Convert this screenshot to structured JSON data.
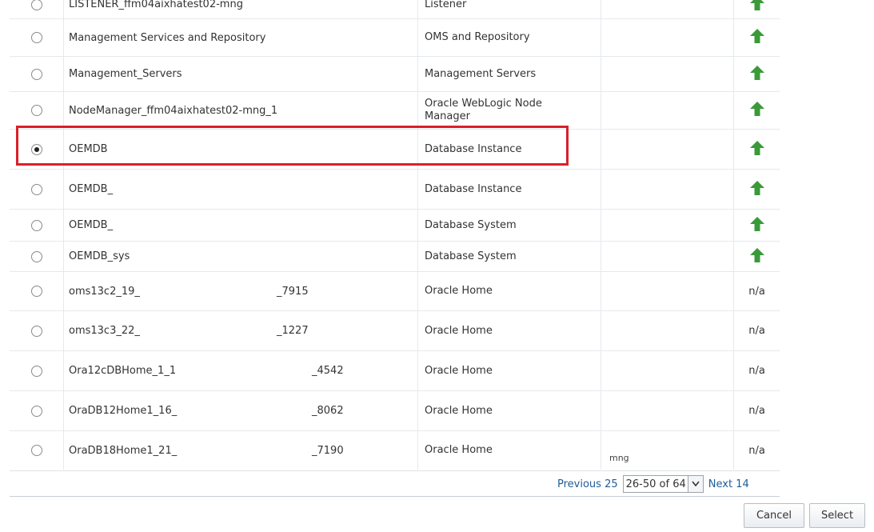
{
  "rows": [
    {
      "name_a": "LISTENER_ffm04aixhatest02-mng",
      "name_b": "",
      "type": "Listener",
      "status": "up",
      "checked": false
    },
    {
      "name_a": "Management Services and Repository",
      "name_b": "",
      "type": "OMS and Repository",
      "status": "up",
      "checked": false
    },
    {
      "name_a": "Management_Servers",
      "name_b": "",
      "type": "Management Servers",
      "status": "up",
      "checked": false
    },
    {
      "name_a": "NodeManager_ffm04aixhatest02-mng_1",
      "name_b": "",
      "type": "Oracle WebLogic Node Manager",
      "status": "up",
      "checked": false
    },
    {
      "name_a": "OEMDB",
      "name_b": "",
      "type": "Database Instance",
      "status": "up",
      "checked": true
    },
    {
      "name_a": "OEMDB_",
      "name_b": "",
      "type": "Database Instance",
      "status": "up",
      "checked": false
    },
    {
      "name_a": "OEMDB_",
      "name_b": "",
      "type": "Database System",
      "status": "up",
      "checked": false
    },
    {
      "name_a": "OEMDB_sys",
      "name_b": "",
      "type": "Database System",
      "status": "up",
      "checked": false
    },
    {
      "name_a": "oms13c2_19_",
      "name_b": "_7915",
      "type": "Oracle Home",
      "status": "n/a",
      "checked": false
    },
    {
      "name_a": "oms13c3_22_",
      "name_b": "_1227",
      "type": "Oracle Home",
      "status": "n/a",
      "checked": false
    },
    {
      "name_a": "Ora12cDBHome_1_1",
      "name_b": "_4542",
      "type": "Oracle Home",
      "status": "n/a",
      "checked": false
    },
    {
      "name_a": "OraDB12Home1_16_",
      "name_b": "_8062",
      "type": "Oracle Home",
      "status": "n/a",
      "checked": false
    },
    {
      "name_a": "OraDB18Home1_21_",
      "name_b": "_7190",
      "type": "Oracle Home",
      "status": "n/a",
      "checked": false
    }
  ],
  "pager": {
    "previous_label": "Previous 25",
    "range_value": "26-50 of 64",
    "next_label": "Next 14"
  },
  "buttons": {
    "cancel_label": "Cancel",
    "select_label": "Select"
  },
  "fragments": {
    "mng_text": "mng"
  },
  "colors": {
    "status_up": "#3a9a3a",
    "highlight": "#d9202a",
    "link": "#1f5c99"
  },
  "icons": {
    "status_up": "up-arrow-icon",
    "dropdown": "chevron-down-icon"
  }
}
